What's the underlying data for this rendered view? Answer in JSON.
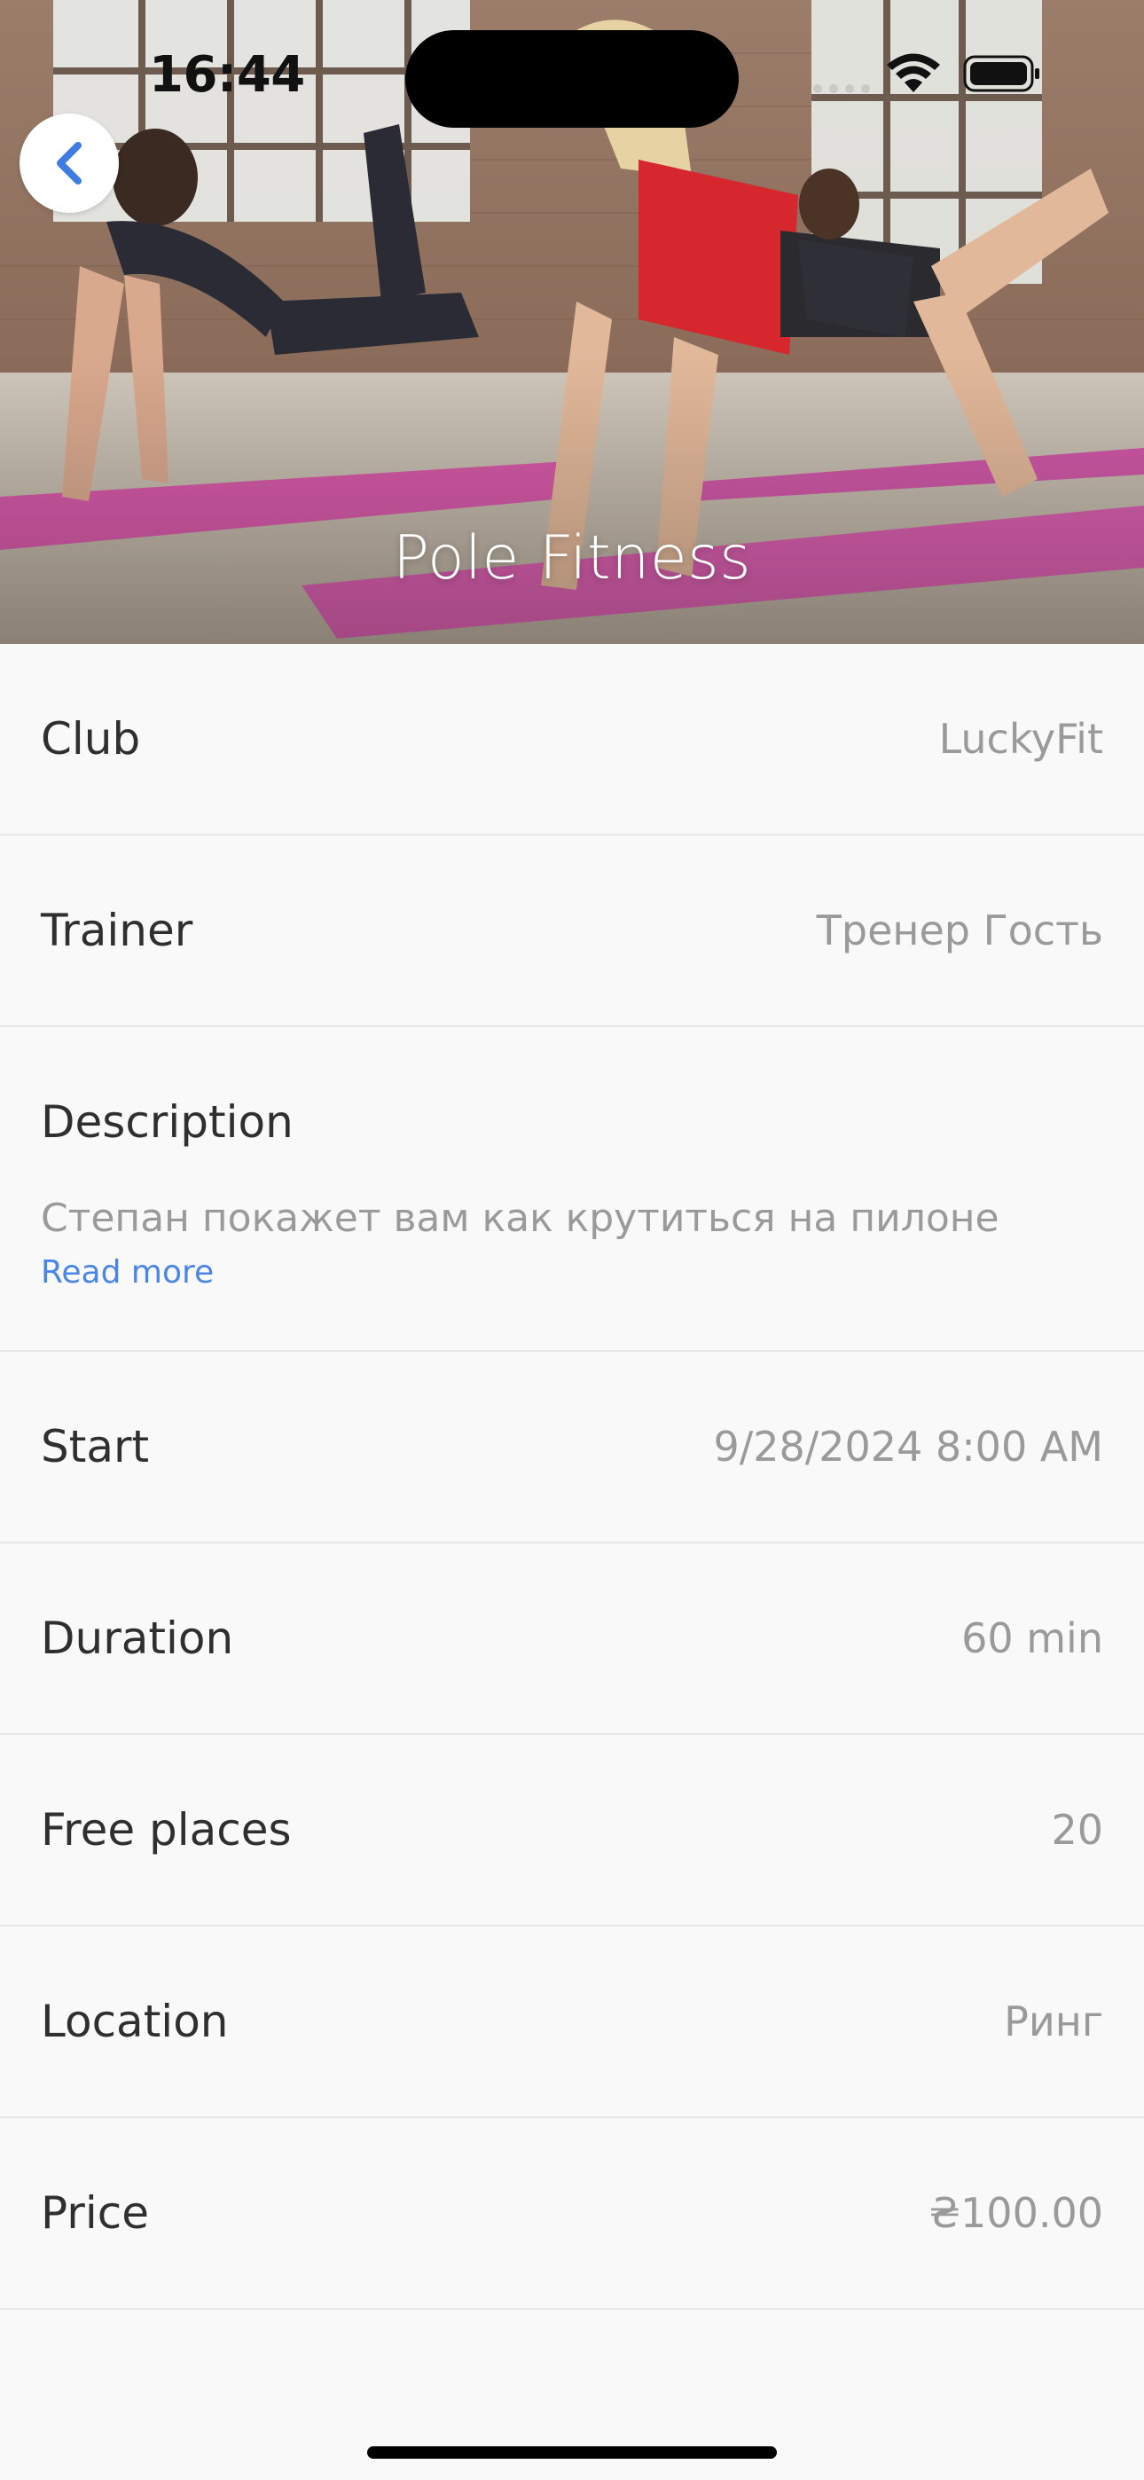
{
  "status_bar": {
    "time": "16:44"
  },
  "header": {
    "title": "Pole Fitness"
  },
  "details": {
    "club": {
      "label": "Club",
      "value": "LuckyFit"
    },
    "trainer": {
      "label": "Trainer",
      "value": "Тренер Гость"
    },
    "description": {
      "label": "Description",
      "text": "Степан покажет вам как крутиться на пилоне",
      "read_more": "Read more"
    },
    "start": {
      "label": "Start",
      "value": "9/28/2024 8:00 AM"
    },
    "duration": {
      "label": "Duration",
      "value": "60 min"
    },
    "free_places": {
      "label": "Free places",
      "value": "20"
    },
    "location": {
      "label": "Location",
      "value": "Ринг"
    },
    "price": {
      "label": "Price",
      "value": "₴100.00"
    }
  },
  "colors": {
    "background": "#f9f9f9",
    "label": "#2f2f2f",
    "value": "#9a9a9a",
    "link": "#4a86e8",
    "divider": "#e6e6e6"
  },
  "icons": {
    "back": "chevron-left-icon",
    "wifi": "wifi-icon",
    "battery": "battery-icon",
    "signal": "cellular-signal-icon"
  }
}
